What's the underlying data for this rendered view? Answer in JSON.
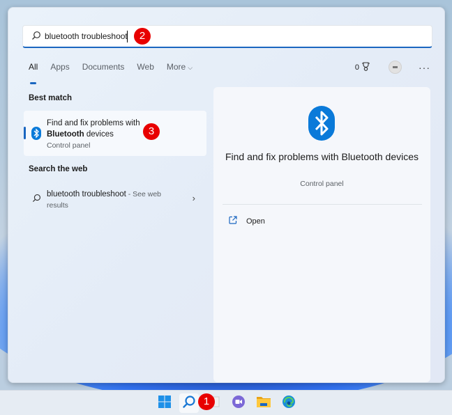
{
  "search": {
    "query": "bluetooth troubleshoot",
    "icon": "search-icon"
  },
  "tabs": [
    {
      "label": "All",
      "active": true
    },
    {
      "label": "Apps",
      "active": false
    },
    {
      "label": "Documents",
      "active": false
    },
    {
      "label": "Web",
      "active": false
    },
    {
      "label": "More",
      "active": false
    }
  ],
  "toolbar": {
    "rewards_points": "0",
    "rewards_icon": "trophy-icon",
    "more_options_label": "···"
  },
  "best_match": {
    "section_title": "Best match",
    "title_line1": "Find and fix problems with",
    "title_bold": "Bluetooth",
    "title_rest": " devices",
    "subtitle": "Control panel",
    "icon": "bluetooth-icon"
  },
  "web_search": {
    "section_title": "Search the web",
    "query": "bluetooth troubleshoot",
    "suffix": " - See web results",
    "chevron": "›"
  },
  "detail": {
    "title": "Find and fix problems with Bluetooth devices",
    "subtitle": "Control panel",
    "actions": [
      {
        "label": "Open",
        "icon": "open-external-icon"
      }
    ]
  },
  "annotations": {
    "step1": "1",
    "step2": "2",
    "step3": "3"
  },
  "taskbar": {
    "items": [
      {
        "name": "start",
        "icon": "windows-start-icon"
      },
      {
        "name": "search",
        "icon": "search-icon",
        "active": true
      },
      {
        "name": "task-view",
        "icon": "task-view-icon"
      },
      {
        "name": "chat",
        "icon": "teams-chat-icon"
      },
      {
        "name": "file-explorer",
        "icon": "folder-icon"
      },
      {
        "name": "edge",
        "icon": "edge-browser-icon"
      }
    ]
  },
  "colors": {
    "accent": "#1a66c0",
    "bluetooth_blue": "#0a7ad9",
    "callout_red": "#e80000"
  }
}
